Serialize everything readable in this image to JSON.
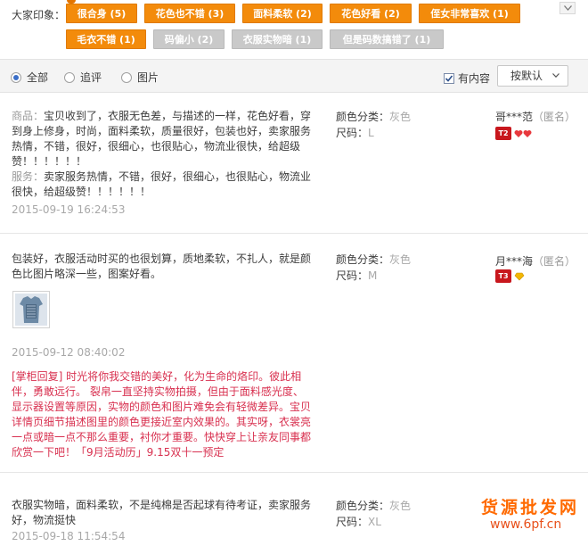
{
  "impressions": {
    "label": "大家印象：",
    "tags": [
      {
        "text": "很合身 (5)",
        "state": "on"
      },
      {
        "text": "花色也不错 (3)",
        "state": "on"
      },
      {
        "text": "面料柔软 (2)",
        "state": "on"
      },
      {
        "text": "花色好看 (2)",
        "state": "on"
      },
      {
        "text": "侄女非常喜欢 (1)",
        "state": "on"
      },
      {
        "text": "毛衣不错 (1)",
        "state": "on"
      },
      {
        "text": "码偏小 (2)",
        "state": "off"
      },
      {
        "text": "衣服实物暗 (1)",
        "state": "off"
      },
      {
        "text": "但是码数搞错了 (1)",
        "state": "off"
      }
    ],
    "collapse_icon": "chevron-up-icon"
  },
  "filters": {
    "all_label": "全部",
    "followup_label": "追评",
    "images_label": "图片",
    "selected": "all",
    "has_content_label": "有内容",
    "has_content_checked": true,
    "sort_label": "按默认"
  },
  "reviews": [
    {
      "goods_label": "商品：",
      "goods_text": "宝贝收到了，衣服无色差，与描述的一样，花色好看，穿到身上修身，时尚，面料柔软，质量很好，包装也好，卖家服务热情，不错，很好，很细心，也很贴心，物流业很快，给超级赞！！！！！！",
      "service_label": "服务：",
      "service_text": "卖家服务热情，不错，很好，很细心，也很贴心，物流业很快，给超级赞！！！！！！",
      "date": "2015-09-19 16:24:53",
      "color_label": "颜色分类：",
      "color_value": "灰色",
      "size_label": "尺码：",
      "size_value": "L",
      "user": "哥***范",
      "anon": "（匿名）",
      "level": "T2"
    },
    {
      "text": "包装好，衣服活动时买的也很划算，质地柔软，不扎人，就是颜色比图片略深一些，图案好看。",
      "date": "2015-09-12 08:40:02",
      "reply": "[掌柜回复] 时光将你我交错的美好，化为生命的烙印。彼此相伴，勇敢远行。 裂帛一直坚持实物拍摄，但由于面料感光度、显示器设置等原因，实物的颜色和图片难免会有轻微差异。宝贝详情页细节描述图里的颜色更接近室内效果的。其实呀，衣裳亮一点或暗一点不那么重要，衬你才重要。快快穿上让亲友同事都欣赏一下吧！「9月活动历」9.15双十一预定",
      "color_label": "颜色分类：",
      "color_value": "灰色",
      "size_label": "尺码：",
      "size_value": "M",
      "user": "月***海",
      "anon": "（匿名）",
      "level": "T3"
    },
    {
      "text": "衣服实物暗，面料柔软，不是纯棉是否起球有待考证，卖家服务好，物流挺快",
      "date": "2015-09-18 11:54:54",
      "color_label": "颜色分类：",
      "color_value": "灰色",
      "size_label": "尺码：",
      "size_value": "XL"
    }
  ],
  "watermark": {
    "line1": "货源批发网",
    "line2": "www.6pf.cn"
  },
  "colors": {
    "tag_on": "#f38b0b",
    "tag_off": "#c9c9c9",
    "reply": "#d8304f",
    "level_badge": "#c8171d"
  }
}
